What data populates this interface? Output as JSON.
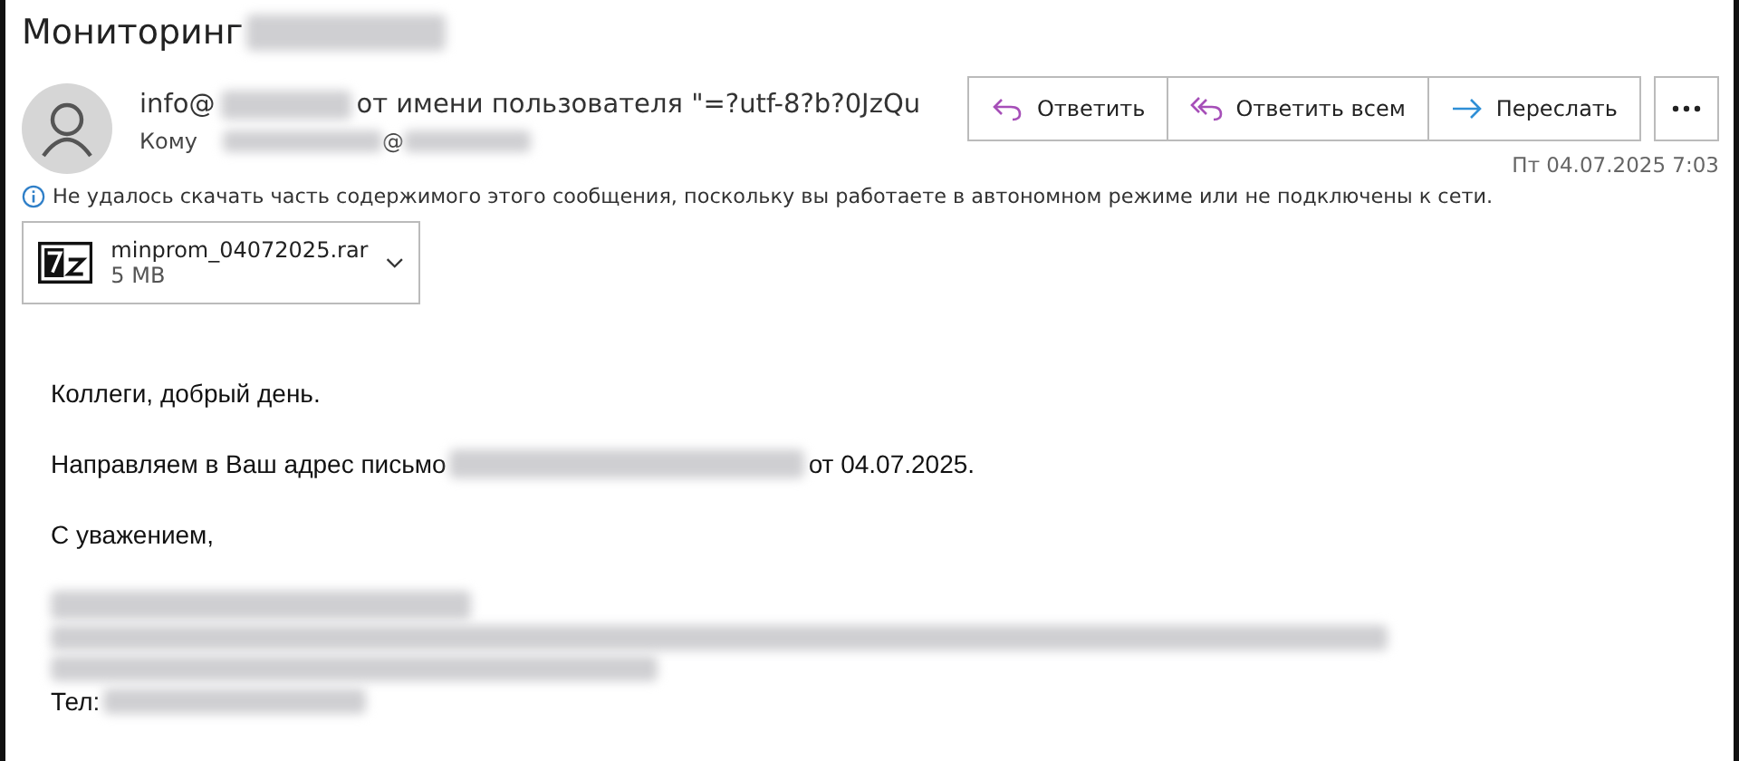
{
  "subject": {
    "title": "Мониторинг"
  },
  "sender": {
    "address_start": "info@",
    "on_behalf": "от имени пользователя \"=?utf-8?b?0JzQu"
  },
  "recipient": {
    "label": "Кому",
    "at_sign": "@"
  },
  "actions": [
    {
      "kind": "reply",
      "label": "Ответить"
    },
    {
      "kind": "reply_all",
      "label": "Ответить всем"
    },
    {
      "kind": "forward",
      "label": "Переслать"
    }
  ],
  "date": "Пт 04.07.2025 7:03",
  "info_bar": "Не удалось скачать часть содержимого этого сообщения, поскольку вы работаете в автономном режиме или не подключены к сети.",
  "attachment": {
    "name": "minprom_04072025.rar",
    "size": "5 MB"
  },
  "body": {
    "greeting": "Коллеги, добрый день.",
    "line_start": "Направляем в Ваш адрес письмо",
    "line_end": "от 04.07.2025.",
    "closing": "С уважением,",
    "phone_label": "Тел:"
  }
}
